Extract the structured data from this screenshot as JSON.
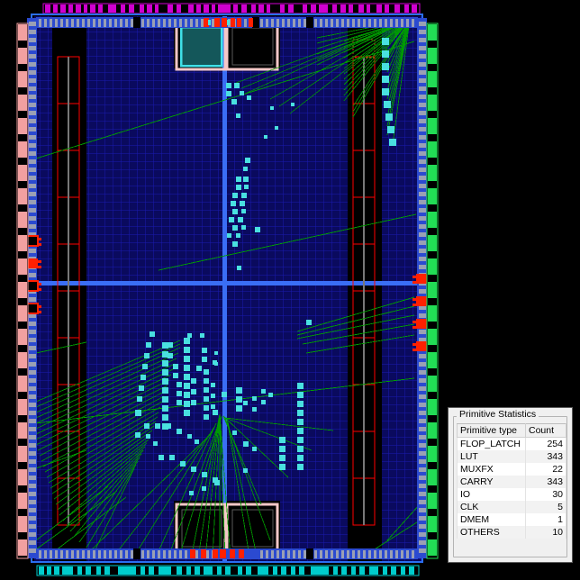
{
  "panel": {
    "group_title": "Primitive Statistics",
    "columns": [
      "Primitive type",
      "Count"
    ],
    "rows": [
      {
        "type": "FLOP_LATCH",
        "count": "254"
      },
      {
        "type": "LUT",
        "count": "343"
      },
      {
        "type": "MUXFX",
        "count": "22"
      },
      {
        "type": "CARRY",
        "count": "343"
      },
      {
        "type": "IO",
        "count": "30"
      },
      {
        "type": "CLK",
        "count": "5"
      },
      {
        "type": "DMEM",
        "count": "1"
      },
      {
        "type": "OTHERS",
        "count": "10"
      }
    ]
  },
  "device_view": {
    "background": "#000000",
    "fabric_fill": "#0a0a66",
    "fabric_grid": "#1a1ab4",
    "die_outline": "#2b6ef0",
    "crosshair": "#3a6ef5",
    "io_cell": "#2b4ad0",
    "io_cell_alt": "#9aa0b4",
    "io_pad_left": "#f2a0a0",
    "io_pad_right": "#22dd55",
    "io_pad_top": "#d000d0",
    "io_pad_bottom": "#00cccc",
    "placed_cell": "#49e0e0",
    "net_line": "#00a000",
    "bram_outline": "#ff0000",
    "bram_spine": "#787878",
    "clock_box_outline": "#f6c8c8",
    "selected_block_fill": "#14575a",
    "selected_block_border": "#3fe0e8",
    "highlight_cell": "#ff2000"
  }
}
